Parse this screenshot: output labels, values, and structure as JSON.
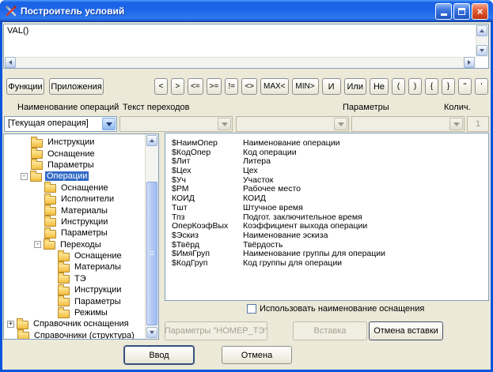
{
  "window": {
    "title": "Построитель условий"
  },
  "icons": {
    "app": "crossed-tools",
    "minimize": "minimize",
    "maximize": "maximize",
    "close": "close",
    "folder": "folder",
    "close_glyph": "×"
  },
  "expression": {
    "value": "VAL()"
  },
  "toolbar": {
    "functions_label": "Функции",
    "applications_label": "Приложения",
    "operators": [
      "<",
      ">",
      "<=",
      ">=",
      "!=",
      "<>",
      "MAX<",
      "MIN>",
      "И",
      "Или",
      "Не",
      "(",
      ")",
      "{",
      "}",
      "\"",
      "'"
    ]
  },
  "selectors": {
    "labels": {
      "operation_name": "Наименование операций",
      "transition_text": "Текст переходов",
      "parameters": "Параметры",
      "quantity": "Колич."
    },
    "operation_combo": {
      "value": "[Текущая операция]"
    },
    "transitions_combo": {
      "value": ""
    },
    "middle_combo": {
      "value": ""
    },
    "parameters_combo": {
      "value": ""
    },
    "quantity_field": {
      "value": "1"
    }
  },
  "tree": {
    "items": [
      {
        "label": "Инструкции",
        "level": 1,
        "expander": "",
        "selected": false
      },
      {
        "label": "Оснащение",
        "level": 1,
        "expander": "",
        "selected": false
      },
      {
        "label": "Параметры",
        "level": 1,
        "expander": "",
        "selected": false
      },
      {
        "label": "Операции",
        "level": 1,
        "expander": "-",
        "selected": true
      },
      {
        "label": "Оснащение",
        "level": 2,
        "expander": "",
        "selected": false
      },
      {
        "label": "Исполнители",
        "level": 2,
        "expander": "",
        "selected": false
      },
      {
        "label": "Материалы",
        "level": 2,
        "expander": "",
        "selected": false
      },
      {
        "label": "Инструкции",
        "level": 2,
        "expander": "",
        "selected": false
      },
      {
        "label": "Параметры",
        "level": 2,
        "expander": "",
        "selected": false
      },
      {
        "label": "Переходы",
        "level": 2,
        "expander": "-",
        "selected": false
      },
      {
        "label": "Оснащение",
        "level": 3,
        "expander": "",
        "selected": false
      },
      {
        "label": "Материалы",
        "level": 3,
        "expander": "",
        "selected": false
      },
      {
        "label": "ТЭ",
        "level": 3,
        "expander": "",
        "selected": false
      },
      {
        "label": "Инструкции",
        "level": 3,
        "expander": "",
        "selected": false
      },
      {
        "label": "Параметры",
        "level": 3,
        "expander": "",
        "selected": false
      },
      {
        "label": "Режимы",
        "level": 3,
        "expander": "",
        "selected": false
      },
      {
        "label": "Справочник оснащения",
        "level": 0,
        "expander": "+",
        "selected": false
      },
      {
        "label": "Справочники (структура)",
        "level": 0,
        "expander": "",
        "selected": false
      }
    ]
  },
  "variables": {
    "rows": [
      {
        "code": "$НаимОпер",
        "description": "Наименование операции"
      },
      {
        "code": "$КодОпер",
        "description": "Код операции"
      },
      {
        "code": "$Лит",
        "description": "Литера"
      },
      {
        "code": "$Цех",
        "description": "Цех"
      },
      {
        "code": "$Уч",
        "description": "Участок"
      },
      {
        "code": "$РМ",
        "description": "Рабочее место"
      },
      {
        "code": "КОИД",
        "description": "КОИД"
      },
      {
        "code": "Тшт",
        "description": "Штучное время"
      },
      {
        "code": "Тпз",
        "description": "Подгот. заключительное время"
      },
      {
        "code": "ОперКоэфВых",
        "description": "Коэффициент выхода операции"
      },
      {
        "code": "$Эскиз",
        "description": "Наименование эскиза"
      },
      {
        "code": "$Твёрд",
        "description": "Твёрдость"
      },
      {
        "code": "$ИмяГруп",
        "description": "Наименование группы для операции"
      },
      {
        "code": "$КодГруп",
        "description": "Код группы для операции"
      }
    ]
  },
  "options": {
    "use_tooling_name": {
      "label": "Использовать наименование оснащения",
      "checked": false
    }
  },
  "actions": {
    "parameters_button": "Параметры \"НОМЕР_ТЭ\"",
    "insert_button": "Вставка",
    "cancel_insert_button": "Отмена вставки",
    "ok_button": "Ввод",
    "cancel_button": "Отмена"
  },
  "colors": {
    "titlebar_blue": "#1D66EA",
    "dialog_background": "#ECE9D8",
    "selection_blue": "#316AC5",
    "field_border": "#7F9DB9",
    "close_button_red": "#D8512C",
    "folder_yellow": "#F3BE3C"
  }
}
